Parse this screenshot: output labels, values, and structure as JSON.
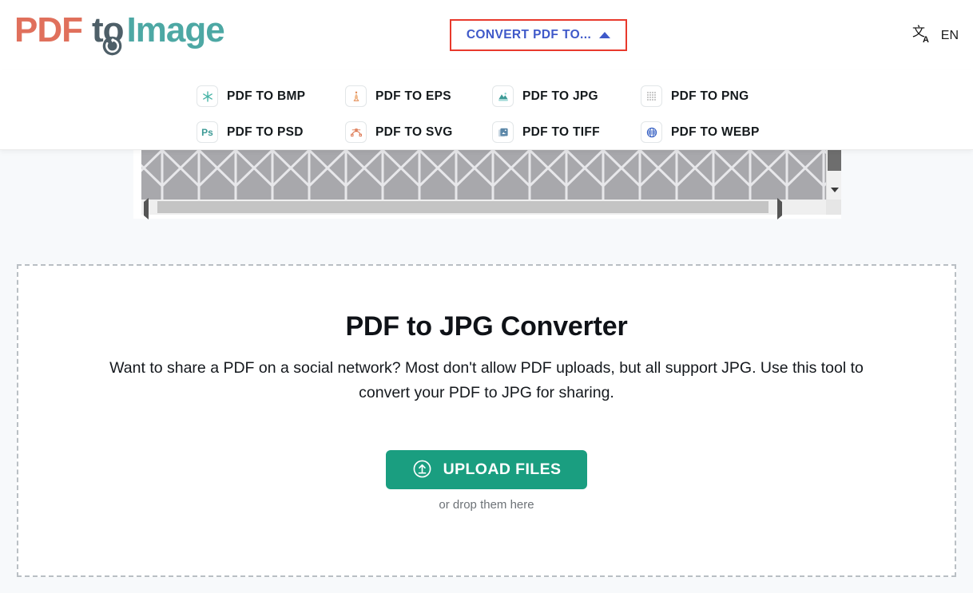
{
  "header": {
    "logo": {
      "part1": "PDF",
      "part2": "to",
      "part3": "Image",
      "refresh_icon": "circular-arrow-icon"
    },
    "convert_nav": {
      "label": "CONVERT PDF TO...",
      "caret_icon": "caret-up-icon"
    },
    "language": {
      "icon": "translate-icon",
      "code": "EN"
    }
  },
  "dropdown": {
    "items": [
      {
        "label": "PDF TO BMP",
        "icon": "asterisk-icon"
      },
      {
        "label": "PDF TO EPS",
        "icon": "eps-figure-icon"
      },
      {
        "label": "PDF TO JPG",
        "icon": "landscape-image-icon"
      },
      {
        "label": "PDF TO PNG",
        "icon": "dot-grid-icon"
      },
      {
        "label": "PDF TO PSD",
        "icon": "photoshop-ps-icon"
      },
      {
        "label": "PDF TO SVG",
        "icon": "bezier-curve-icon"
      },
      {
        "label": "PDF TO TIFF",
        "icon": "stacked-images-icon"
      },
      {
        "label": "PDF TO WEBP",
        "icon": "globe-icon"
      }
    ]
  },
  "scroll_panel": {
    "vertical_scrollbar": "vertical-scrollbar",
    "horizontal_scrollbar": "horizontal-scrollbar"
  },
  "dropzone": {
    "title": "PDF to JPG Converter",
    "description": "Want to share a PDF on a social network? Most don't allow PDF uploads, but all support JPG. Use this tool to convert your PDF to JPG for sharing.",
    "upload_button": {
      "label": "UPLOAD FILES",
      "icon": "upload-circle-icon"
    },
    "drop_text": "or drop them here"
  },
  "colors": {
    "logo_pdf": "#e0705c",
    "logo_to": "#4e5f68",
    "logo_image": "#4da8a4",
    "nav_link": "#3f59c9",
    "highlight_box": "#e8392c",
    "upload_green": "#1a9e80",
    "page_bg": "#f7f9fb"
  }
}
